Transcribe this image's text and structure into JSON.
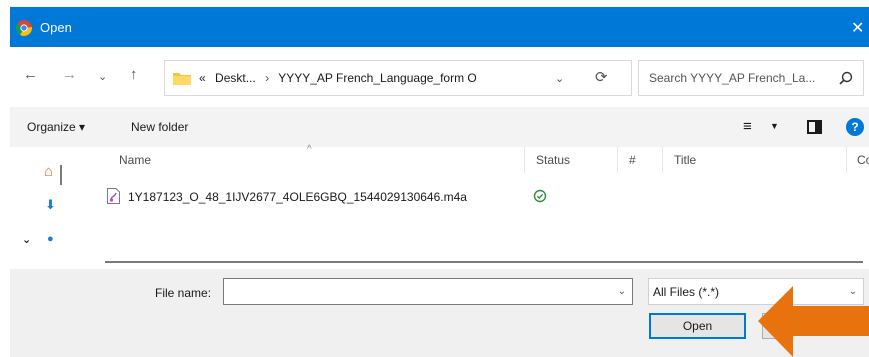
{
  "window": {
    "title": "Open",
    "close_glyph": "✕"
  },
  "nav": {
    "back_glyph": "←",
    "forward_glyph": "→",
    "recent_glyph": "⌄",
    "up_glyph": "↑"
  },
  "address": {
    "overflow": "«",
    "crumb_1": "Deskt...",
    "separator": "›",
    "crumb_2": "YYYY_AP French_Language_form O",
    "refresh_glyph": "⟳"
  },
  "search": {
    "placeholder": "Search YYYY_AP French_La..."
  },
  "toolbar": {
    "organize_label": "Organize ▾",
    "new_folder_label": "New folder",
    "help_label": "?"
  },
  "columns": {
    "name": "Name",
    "status": "Status",
    "number": "#",
    "title": "Title",
    "contributing": "Cor"
  },
  "files": [
    {
      "name": "1Y187123_O_48_1IJV2677_4OLE6GBQ_1544029130646.m4a",
      "status": "available"
    }
  ],
  "bottom": {
    "file_name_label": "File name:",
    "file_name_value": "",
    "file_type_value": "All Files (*.*)",
    "open_label": "Open"
  },
  "colors": {
    "titlebar": "#0078d7",
    "annotation_arrow": "#e8730e",
    "status_ok": "#2e8b3e"
  },
  "icons": {
    "app": "chrome-icon",
    "folder": "folder-icon",
    "search": "search-icon",
    "file": "audio-file-icon",
    "status": "check-circle-icon"
  }
}
